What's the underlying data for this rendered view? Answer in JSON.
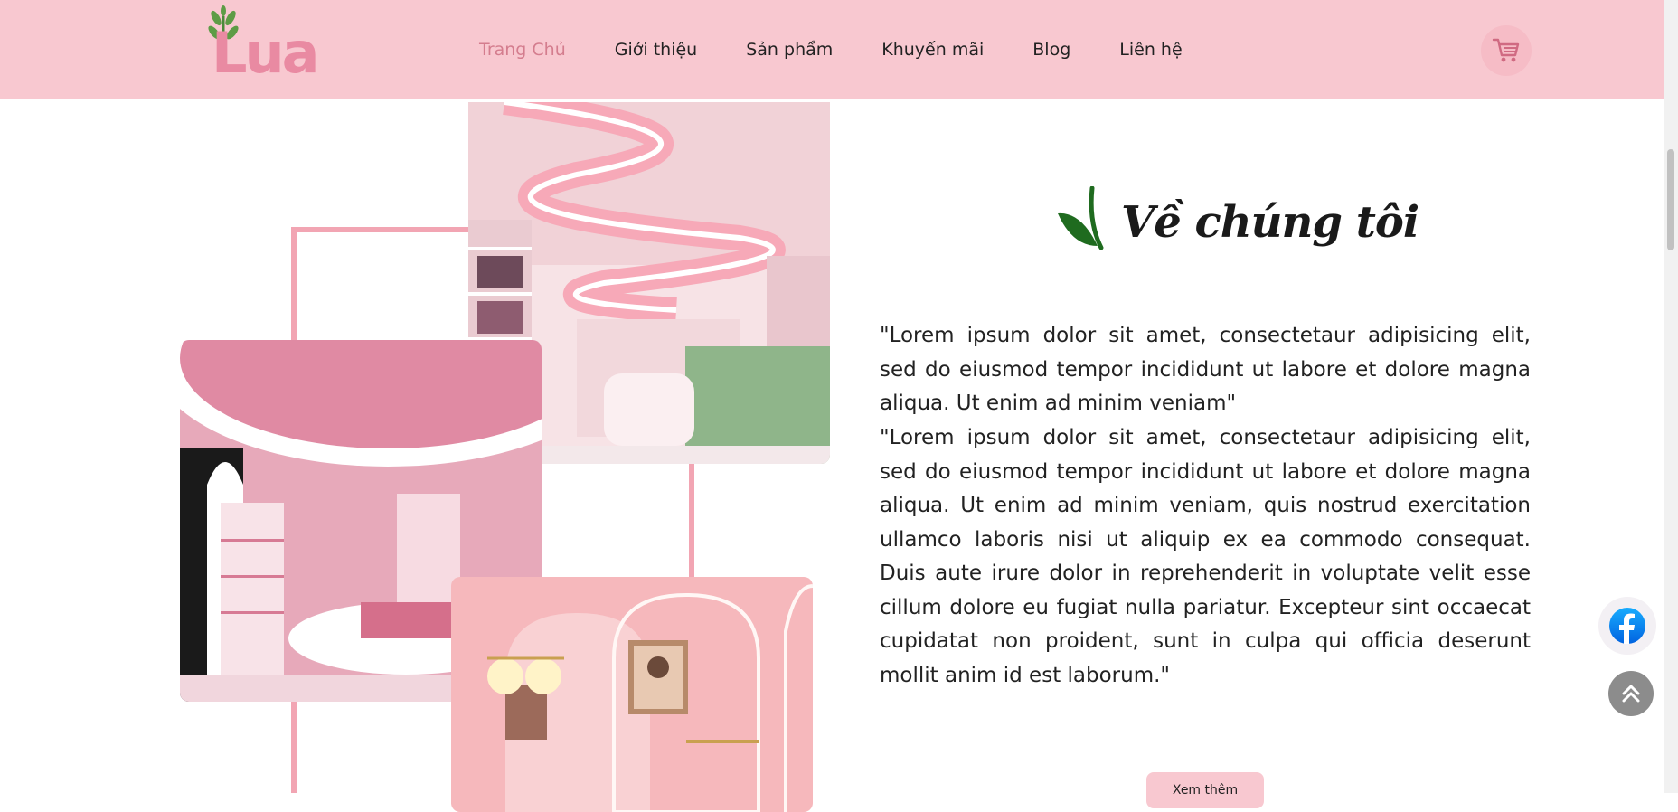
{
  "brand": {
    "logo_text": "Lua"
  },
  "nav": {
    "items": [
      {
        "label": "Trang Chủ",
        "active": true
      },
      {
        "label": "Giới thiệu",
        "active": false
      },
      {
        "label": "Sản phẩm",
        "active": false
      },
      {
        "label": "Khuyến mãi",
        "active": false
      },
      {
        "label": "Blog",
        "active": false
      },
      {
        "label": "Liên hệ",
        "active": false
      }
    ]
  },
  "header": {
    "cart_icon": "cart-icon"
  },
  "about": {
    "title": "Về chúng tôi",
    "paragraph_1": "\"Lorem ipsum dolor sit amet, consectetaur adipisicing elit, sed do eiusmod tempor incididunt ut labore et dolore magna aliqua. Ut enim ad minim veniam\"",
    "paragraph_2": "\"Lorem ipsum dolor sit amet, consectetaur adipisicing elit, sed do eiusmod tempor incididunt ut labore et dolore magna aliqua. Ut enim ad minim veniam, quis nostrud exercitation ullamco laboris nisi ut aliquip ex ea commodo consequat. Duis aute irure dolor in reprehenderit in voluptate velit esse cillum dolore eu fugiat nulla pariatur. Excepteur sint occaecat cupidatat non proident, sunt in culpa qui officia deserunt mollit anim id est laborum.\"",
    "more_button": "Xem thêm"
  },
  "floating": {
    "facebook_icon": "facebook-icon",
    "back_to_top_icon": "chevrons-up-icon"
  },
  "colors": {
    "header_bg": "#f8c8d0",
    "accent_pink": "#e98aa2",
    "active_nav": "#d47d8e",
    "leaf_green": "#1f6b1f"
  }
}
